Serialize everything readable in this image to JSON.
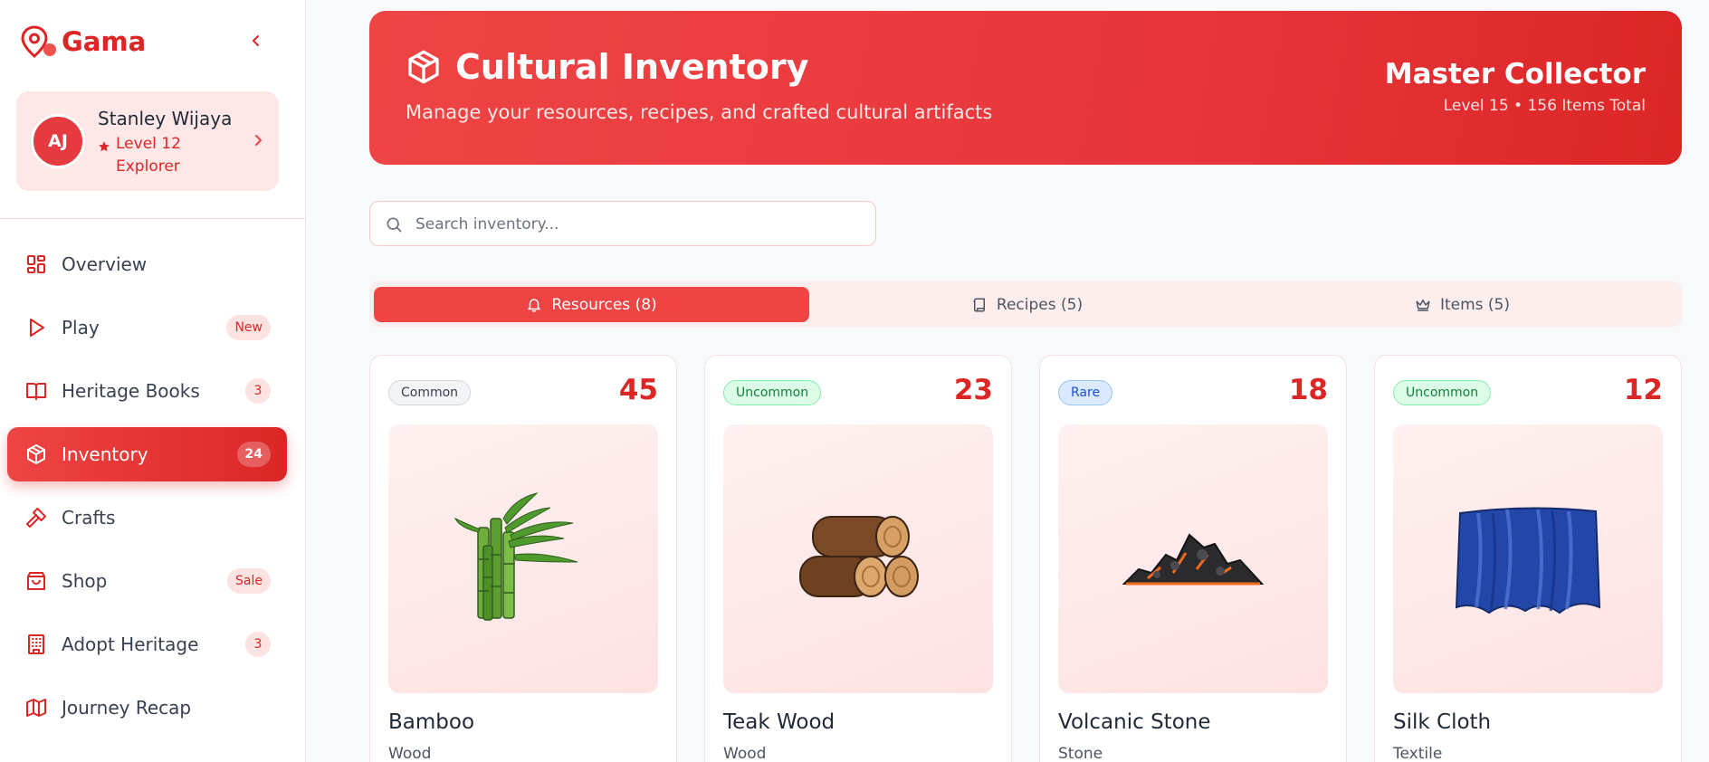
{
  "brand": {
    "name": "Gama"
  },
  "profile": {
    "initials": "AJ",
    "name": "Stanley Wijaya",
    "level": "Level 12 Explorer"
  },
  "nav": [
    {
      "label": "Overview",
      "badge": null,
      "icon": "grid-icon"
    },
    {
      "label": "Play",
      "badge": "New",
      "icon": "play-icon"
    },
    {
      "label": "Heritage Books",
      "badge": "3",
      "icon": "book-icon"
    },
    {
      "label": "Inventory",
      "badge": "24",
      "icon": "box-icon",
      "active": true
    },
    {
      "label": "Crafts",
      "badge": null,
      "icon": "hammer-icon"
    },
    {
      "label": "Shop",
      "badge": "Sale",
      "icon": "shopping-bag-icon"
    },
    {
      "label": "Adopt Heritage",
      "badge": "3",
      "icon": "building-icon"
    },
    {
      "label": "Journey Recap",
      "badge": null,
      "icon": "map-icon"
    }
  ],
  "hero": {
    "title": "Cultural Inventory",
    "subtitle": "Manage your resources, recipes, and crafted cultural artifacts",
    "rank": "Master Collector",
    "stats": "Level 15 • 156 Items Total"
  },
  "search": {
    "placeholder": "Search inventory...",
    "value": ""
  },
  "tabs": [
    {
      "label": "Resources (8)",
      "icon": "bell-icon",
      "active": true
    },
    {
      "label": "Recipes (5)",
      "icon": "scroll-icon",
      "active": false
    },
    {
      "label": "Items (5)",
      "icon": "crown-icon",
      "active": false
    }
  ],
  "items": [
    {
      "rarity": "Common",
      "count": "45",
      "name": "Bamboo",
      "category": "Wood",
      "image": "bamboo-image"
    },
    {
      "rarity": "Uncommon",
      "count": "23",
      "name": "Teak Wood",
      "category": "Wood",
      "image": "teak-logs-image"
    },
    {
      "rarity": "Rare",
      "count": "18",
      "name": "Volcanic Stone",
      "category": "Stone",
      "image": "volcanic-stone-image"
    },
    {
      "rarity": "Uncommon",
      "count": "12",
      "name": "Silk Cloth",
      "category": "Textile",
      "image": "silk-cloth-image"
    }
  ],
  "colors": {
    "accent": "#dc2626",
    "accent_light": "#ef4444",
    "rarity_common": "#6b7280",
    "rarity_uncommon": "#16a34a",
    "rarity_rare": "#2563eb"
  }
}
